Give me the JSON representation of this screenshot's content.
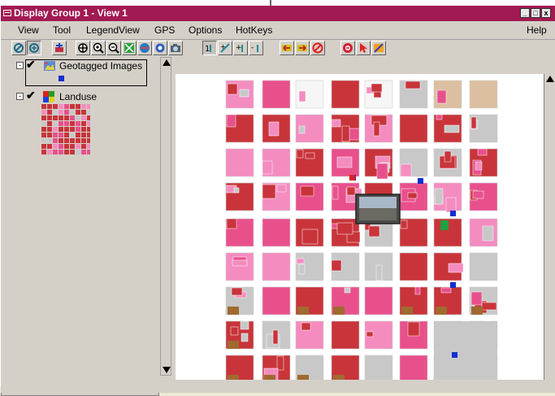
{
  "window": {
    "title": "Display Group 1 - View 1",
    "title_bar_color": "#a21a52"
  },
  "menu": {
    "items": [
      "View",
      "Tool",
      "LegendView",
      "GPS",
      "Options",
      "HotKeys"
    ],
    "help": "Help"
  },
  "toolbar": {
    "buttons": [
      "select-icon",
      "identify-icon",
      "add-layer-icon",
      "pan-icon",
      "zoom-in-icon",
      "zoom-out-icon",
      "zoom-extent-icon",
      "zoom-layer-icon",
      "refresh-icon",
      "snapshot-icon",
      "measure-icon",
      "point-tool-icon",
      "line-tool-icon",
      "polygon-tool-icon",
      "back-icon",
      "forward-icon",
      "clear-icon",
      "zoom-selected-icon",
      "pointer-icon",
      "draw-icon"
    ]
  },
  "legend": {
    "layers": [
      {
        "name": "Geotagged Images",
        "checked": true,
        "symbol_color": "#1030d0"
      },
      {
        "name": "Landuse",
        "checked": true
      }
    ]
  },
  "colors": {
    "commercial": "#c8343a",
    "residential": "#f48cc0",
    "pink": "#e8508c",
    "gray": "#c8c8c8",
    "tan": "#dcbfa0",
    "brown": "#a06a30",
    "point": "#1030d0"
  }
}
